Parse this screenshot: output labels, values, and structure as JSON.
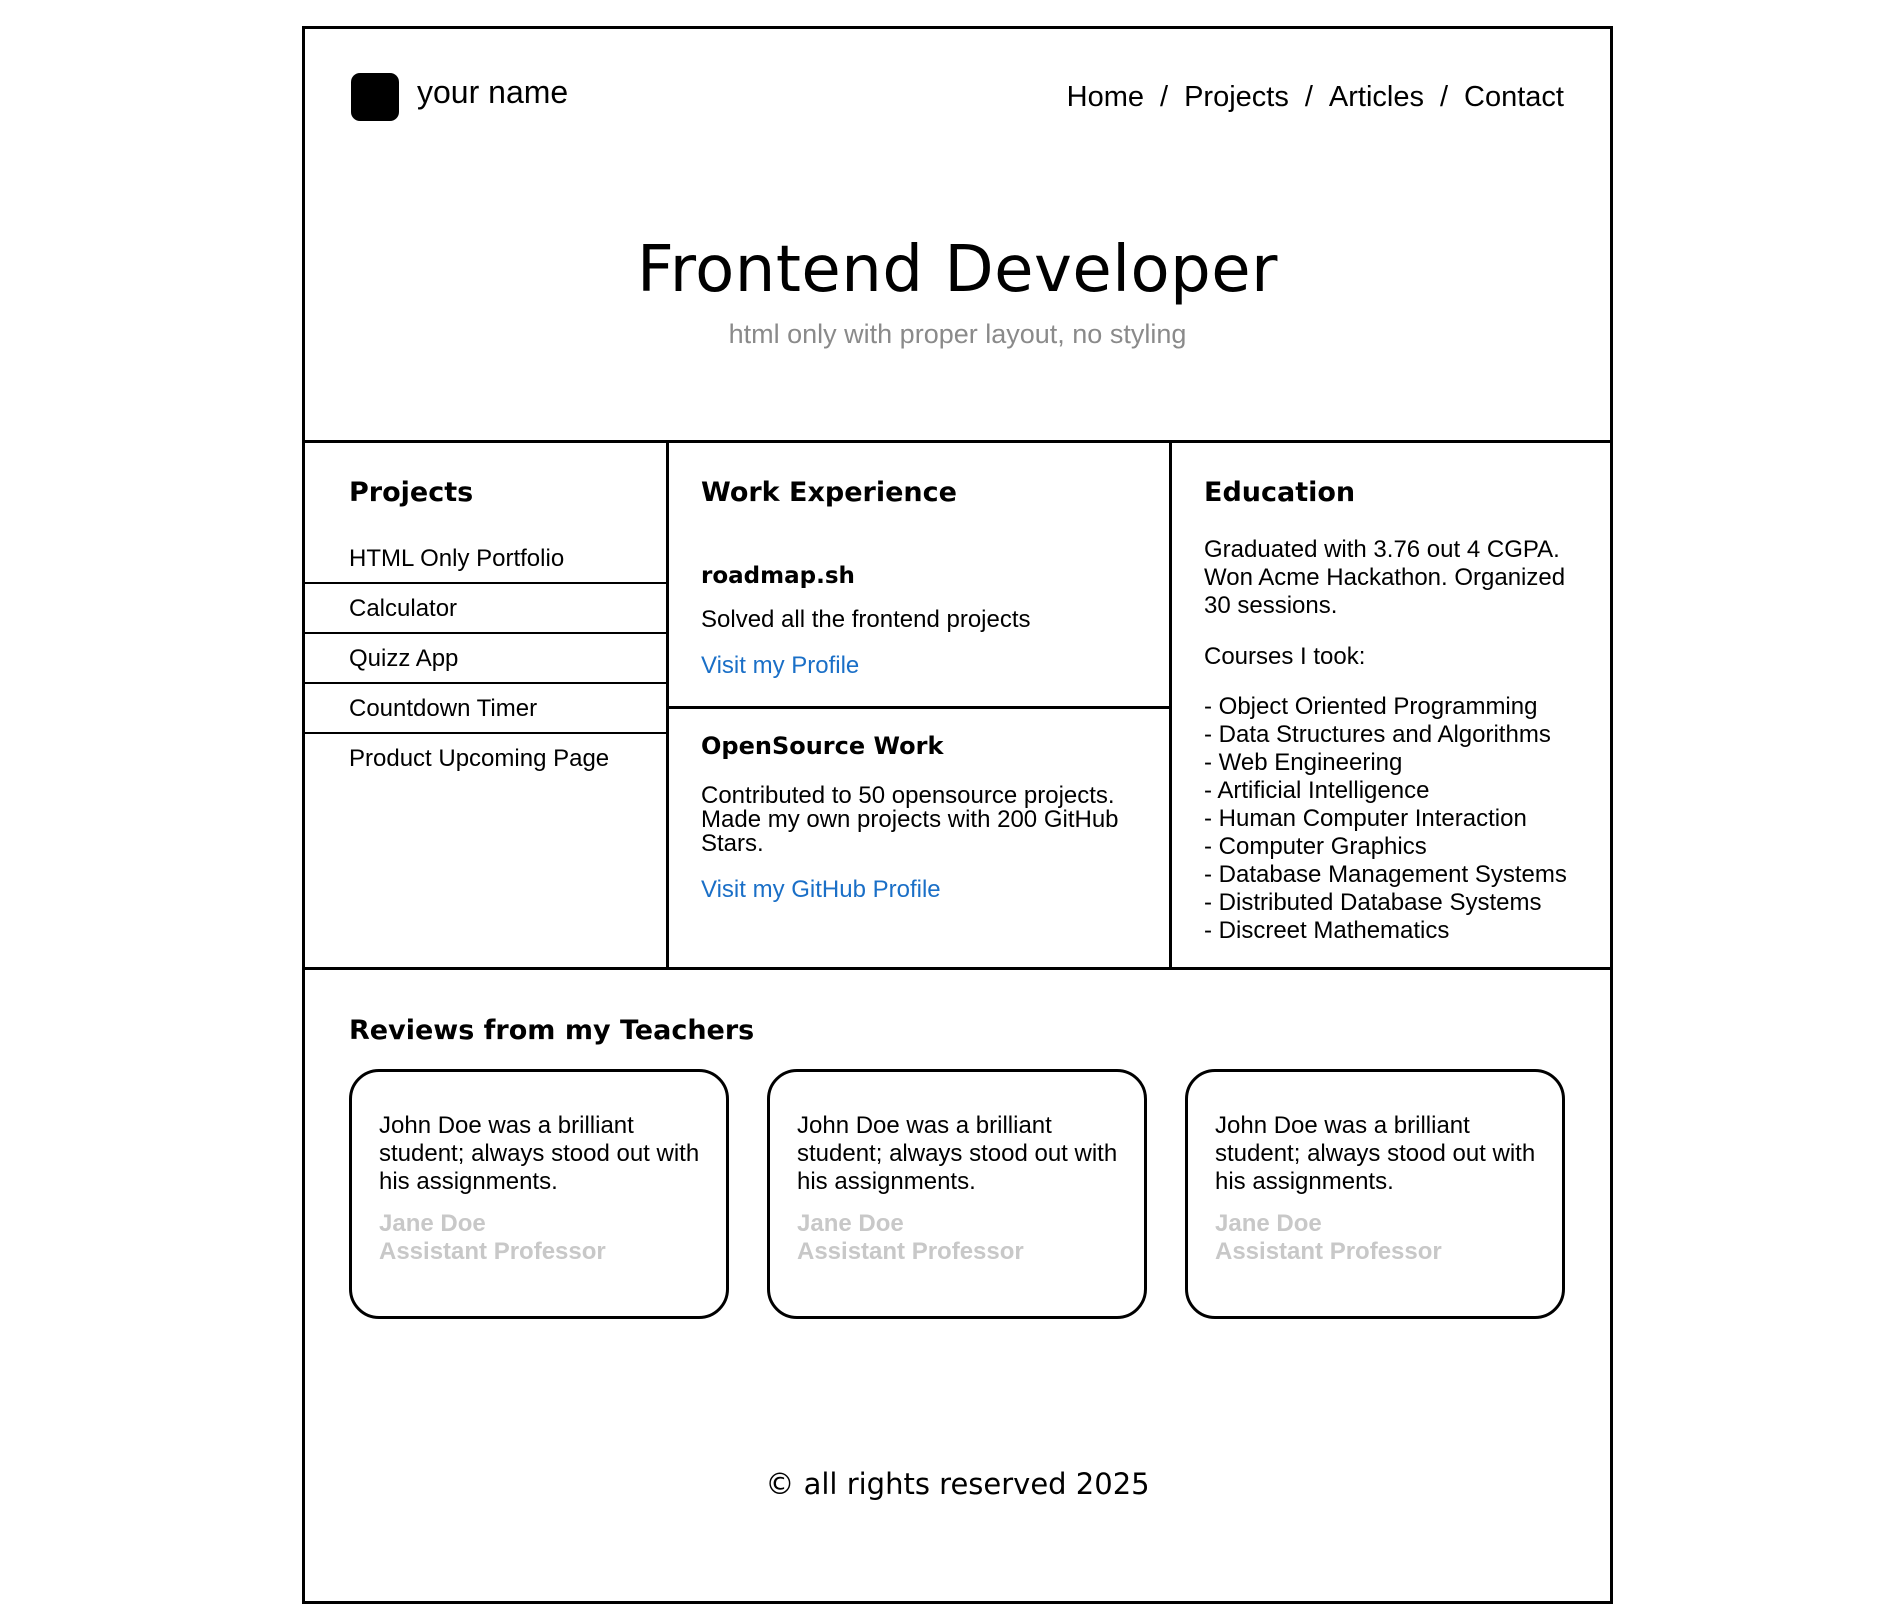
{
  "header": {
    "brand": "your name",
    "nav": [
      {
        "label": "Home"
      },
      {
        "label": "Projects"
      },
      {
        "label": "Articles"
      },
      {
        "label": "Contact"
      }
    ],
    "nav_separator": "/"
  },
  "hero": {
    "title": "Frontend Developer",
    "subtitle": "html only with proper layout, no styling"
  },
  "projects": {
    "title": "Projects",
    "items": [
      "HTML Only Portfolio",
      "Calculator",
      "Quizz App",
      "Countdown Timer",
      "Product Upcoming Page"
    ]
  },
  "work": {
    "title": "Work Experience",
    "company": "roadmap.sh",
    "description": "Solved all the frontend projects",
    "link": "Visit my Profile",
    "opensource_title": "OpenSource Work",
    "opensource_description": "Contributed to 50 opensource projects. Made my own projects with 200 GitHub Stars.",
    "opensource_link": "Visit my GitHub Profile"
  },
  "education": {
    "title": "Education",
    "summary": "Graduated with 3.76 out 4 CGPA. Won Acme Hackathon. Organized 30 sessions.",
    "courses_label": "Courses I took:",
    "courses": [
      "- Object Oriented Programming",
      "- Data Structures and Algorithms",
      "- Web Engineering",
      "- Artificial Intelligence",
      "- Human Computer Interaction",
      "- Computer Graphics",
      "- Database Management Systems",
      "- Distributed Database Systems",
      "- Discreet Mathematics"
    ]
  },
  "reviews": {
    "title": "Reviews from my Teachers",
    "items": [
      {
        "text": "John Doe was a brilliant student; always stood out with his assignments.",
        "name": "Jane Doe",
        "role": "Assistant Professor"
      },
      {
        "text": "John Doe was a brilliant student; always stood out with his assignments.",
        "name": "Jane Doe",
        "role": "Assistant Professor"
      },
      {
        "text": "John Doe was a brilliant student; always stood out with his assignments.",
        "name": "Jane Doe",
        "role": "Assistant Professor"
      }
    ]
  },
  "footer": {
    "text": "© all rights reserved 2025"
  },
  "colors": {
    "link": "#1a6fc7",
    "subtitle": "#8a8a8a",
    "review_meta": "#c8c8c8"
  }
}
